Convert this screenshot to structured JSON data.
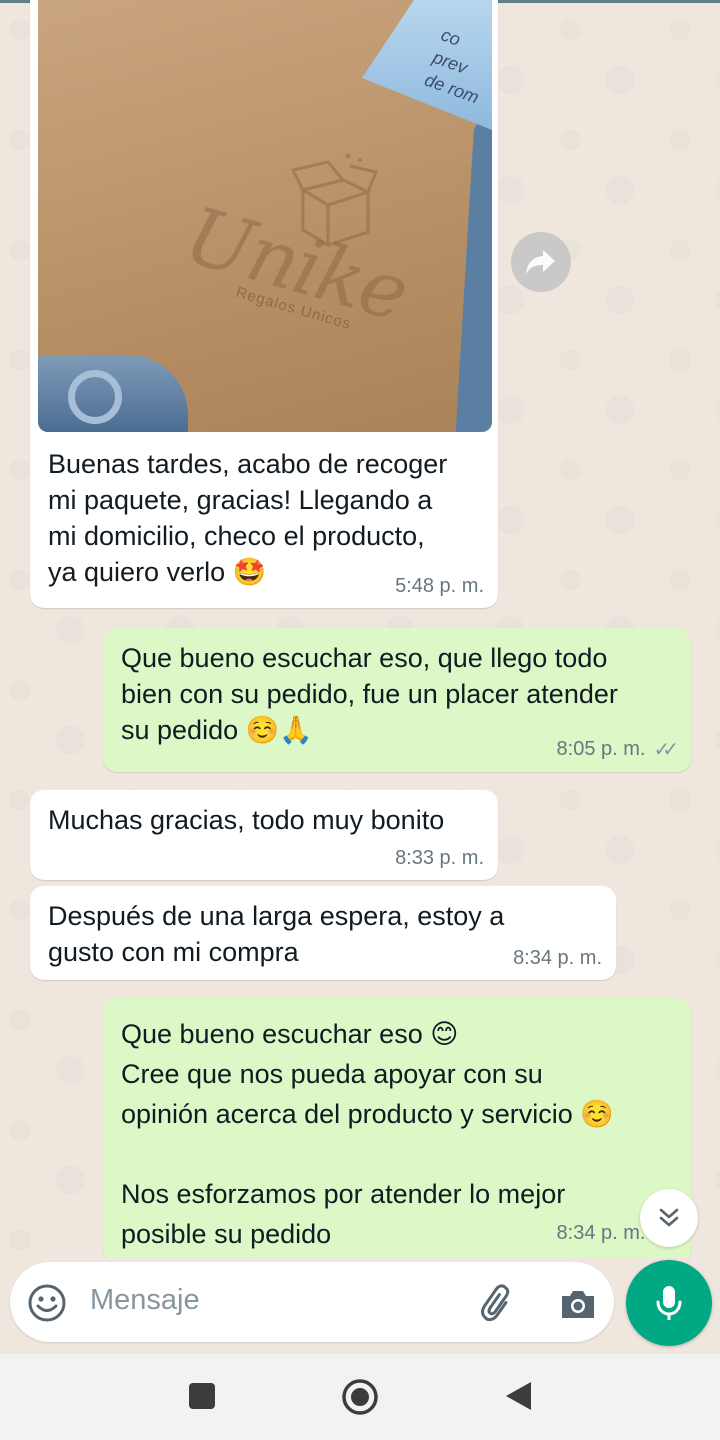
{
  "chat": {
    "photo_message": {
      "image_text": {
        "brand": "Unike",
        "tagline": "Regalos Unicos",
        "flap": "co\nprev\nde rom"
      },
      "caption": "Buenas tardes, acabo de recoger\nmi paquete, gracias! Llegando a\nmi domicilio, checo el producto,\nya quiero verlo 🤩",
      "time": "5:48 p. m."
    },
    "messages": [
      {
        "id": "m2",
        "direction": "out",
        "text": "Que bueno escuchar eso, que llego todo\nbien con su pedido, fue un placer atender\nsu pedido ☺️🙏",
        "time": "8:05 p. m.",
        "ticks": "✓✓"
      },
      {
        "id": "m3",
        "direction": "in",
        "text": "Muchas gracias, todo muy bonito",
        "time": "8:33 p. m."
      },
      {
        "id": "m4",
        "direction": "in",
        "text": "Después de una larga espera, estoy a\ngusto con mi compra",
        "time": "8:34 p. m."
      },
      {
        "id": "m5",
        "direction": "out",
        "text": "Que bueno escuchar eso 😊\nCree que nos pueda apoyar con su\nopinión acerca del producto y servicio ☺️\n\nNos esforzamos por atender lo mejor\nposible su pedido",
        "time": "8:34 p. m.",
        "ticks": "✓✓"
      }
    ]
  },
  "input": {
    "placeholder": "Mensaje"
  },
  "icons": {
    "emoji": "emoji-icon",
    "attach": "paperclip-icon",
    "camera": "camera-icon",
    "mic": "microphone-icon",
    "forward": "forward-icon",
    "scroll": "chevron-double-down-icon",
    "nav_recents": "recents-square-icon",
    "nav_home": "home-circle-icon",
    "nav_back": "back-triangle-icon"
  },
  "colors": {
    "incoming": "#ffffff",
    "outgoing": "#dcf8c6",
    "accent": "#00a884",
    "wallpaper": "#efe7de"
  }
}
